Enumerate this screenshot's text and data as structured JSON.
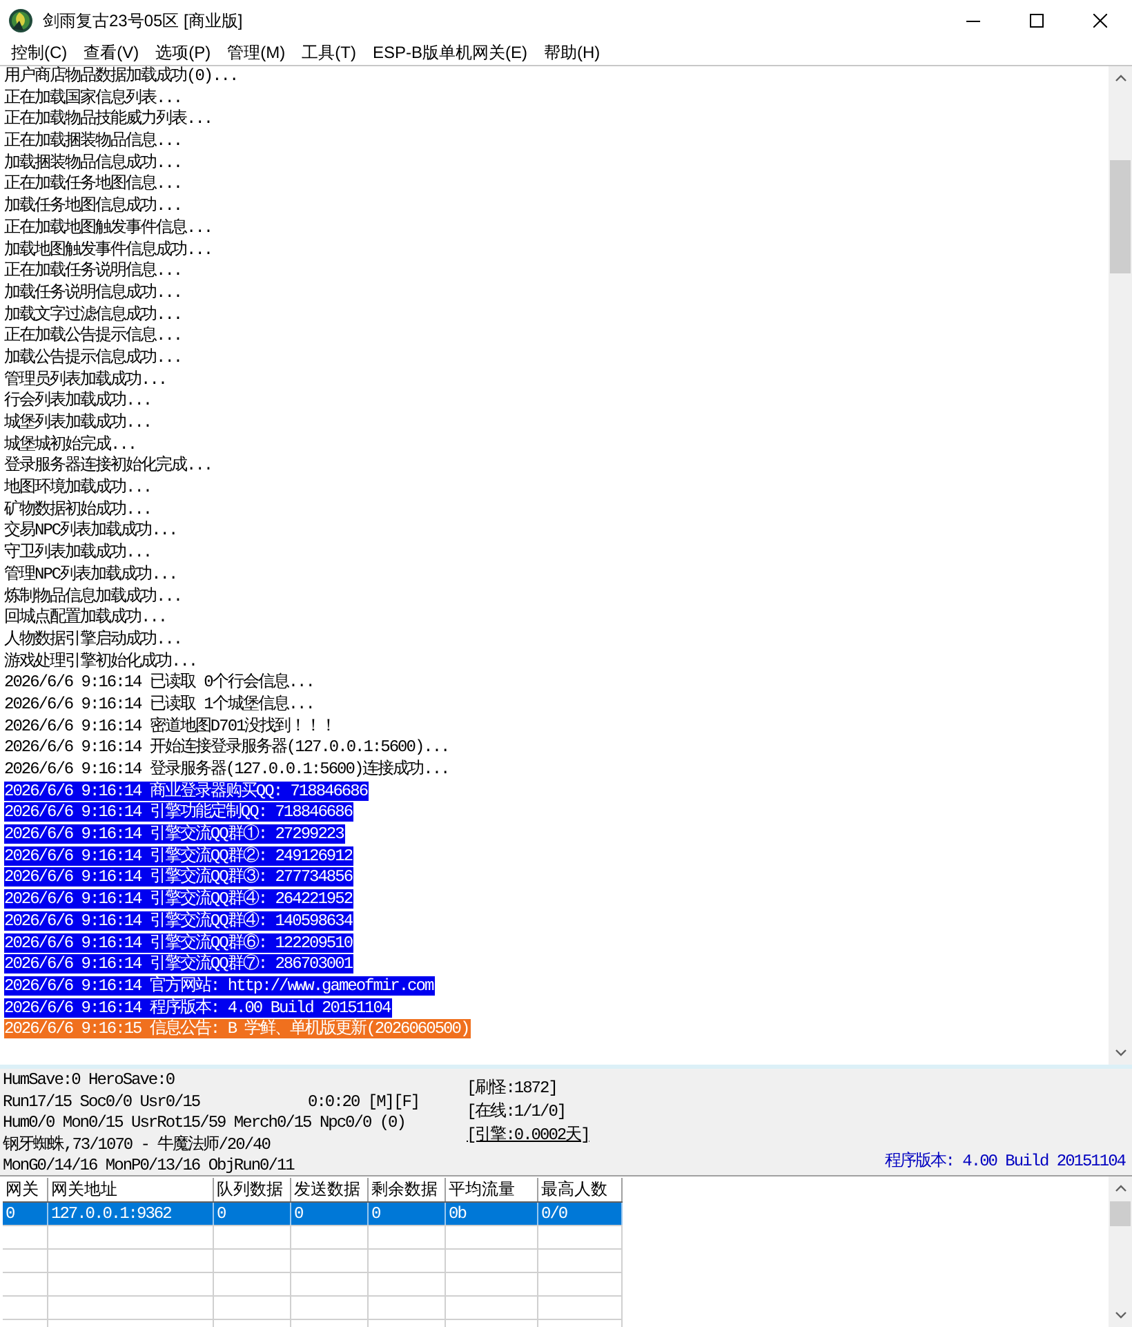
{
  "window": {
    "title": "剑雨复古23号05区 [商业版]"
  },
  "menu": [
    "控制(C)",
    "查看(V)",
    "选项(P)",
    "管理(M)",
    "工具(T)",
    "ESP-B版单机网关(E)",
    "帮助(H)"
  ],
  "log": {
    "lines": [
      {
        "text": "用户商店物品数据加载成功(0)..."
      },
      {
        "text": "正在加载国家信息列表..."
      },
      {
        "text": "正在加载物品技能威力列表..."
      },
      {
        "text": "正在加载捆装物品信息..."
      },
      {
        "text": "加载捆装物品信息成功..."
      },
      {
        "text": "正在加载任务地图信息..."
      },
      {
        "text": "加载任务地图信息成功..."
      },
      {
        "text": "正在加载地图触发事件信息..."
      },
      {
        "text": "加载地图触发事件信息成功..."
      },
      {
        "text": "正在加载任务说明信息..."
      },
      {
        "text": "加载任务说明信息成功..."
      },
      {
        "text": "加载文字过滤信息成功..."
      },
      {
        "text": "正在加载公告提示信息..."
      },
      {
        "text": "加载公告提示信息成功..."
      },
      {
        "text": "管理员列表加载成功..."
      },
      {
        "text": "行会列表加载成功..."
      },
      {
        "text": "城堡列表加载成功..."
      },
      {
        "text": "城堡城初始完成..."
      },
      {
        "text": "登录服务器连接初始化完成..."
      },
      {
        "text": "地图环境加载成功..."
      },
      {
        "text": "矿物数据初始成功..."
      },
      {
        "text": "交易NPC列表加载成功..."
      },
      {
        "text": "守卫列表加载成功..."
      },
      {
        "text": "管理NPC列表加载成功..."
      },
      {
        "text": "炼制物品信息加载成功..."
      },
      {
        "text": "回城点配置加载成功..."
      },
      {
        "text": "人物数据引擎启动成功..."
      },
      {
        "text": "游戏处理引擎初始化成功..."
      },
      {
        "text": "2026/6/6 9:16:14 已读取 0个行会信息..."
      },
      {
        "text": "2026/6/6 9:16:14 已读取 1个城堡信息..."
      },
      {
        "text": "2026/6/6 9:16:14 密道地图D701没找到！！！"
      },
      {
        "text": "2026/6/6 9:16:14 开始连接登录服务器(127.0.0.1:5600)..."
      },
      {
        "text": "2026/6/6 9:16:14 登录服务器(127.0.0.1:5600)连接成功..."
      },
      {
        "text": "2026/6/6 9:16:14 商业登录器购买QQ: 718846686",
        "color": "#0000f0"
      },
      {
        "text": "2026/6/6 9:16:14 引擎功能定制QQ: 718846686",
        "color": "#0000f0"
      },
      {
        "text": "2026/6/6 9:16:14 引擎交流QQ群①: 27299223",
        "color": "#0000f0"
      },
      {
        "text": "2026/6/6 9:16:14 引擎交流QQ群②: 249126912",
        "color": "#0000f0"
      },
      {
        "text": "2026/6/6 9:16:14 引擎交流QQ群③: 277734856",
        "color": "#0000f0"
      },
      {
        "text": "2026/6/6 9:16:14 引擎交流QQ群④: 264221952",
        "color": "#0000f0"
      },
      {
        "text": "2026/6/6 9:16:14 引擎交流QQ群④: 140598634",
        "color": "#0000f0"
      },
      {
        "text": "2026/6/6 9:16:14 引擎交流QQ群⑥: 122209510",
        "color": "#0000f0"
      },
      {
        "text": "2026/6/6 9:16:14 引擎交流QQ群⑦: 286703001",
        "color": "#0000f0"
      },
      {
        "text": "2026/6/6 9:16:14 官方网站: http://www.gameofmir.com",
        "color": "#0000f0"
      },
      {
        "text": "2026/6/6 9:16:14 程序版本: 4.00 Build 20151104",
        "color": "#0000f0"
      },
      {
        "text": "2026/6/6 9:16:15 信息公告: B 学鲜、单机版更新(2026060500)",
        "color": "#f0701e"
      }
    ]
  },
  "status": {
    "lines": [
      {
        "text": "HumSave:0 HeroSave:0"
      },
      {
        "text": "Run17/15 Soc0/0 Usr0/15",
        "aside": "0:0:20 [M][F]"
      },
      {
        "text": "Hum0/0 Mon0/15 UsrRot15/59 Merch0/15 Npc0/0 (0)"
      },
      {
        "text": "钢牙蜘蛛,73/1070 - 牛魔法师/20/40"
      },
      {
        "text": "MonG0/14/16 MonP0/13/16 ObjRun0/11"
      }
    ],
    "counters": [
      {
        "text": "[刷怪:1872]",
        "link": false
      },
      {
        "text": "[在线:1/1/0]",
        "link": false
      },
      {
        "text": "[引擎:0.0002天]",
        "link": true
      }
    ],
    "version": "程序版本: 4.00 Build 20151104"
  },
  "gateway_table": {
    "columns": [
      "网关",
      "网关地址",
      "队列数据",
      "发送数据",
      "剩余数据",
      "平均流量",
      "最高人数"
    ],
    "rows": [
      {
        "cells": [
          "0",
          "127.0.0.1:9362",
          "0",
          "0",
          "0",
          "0b",
          "0/0"
        ],
        "selected": true
      }
    ]
  }
}
